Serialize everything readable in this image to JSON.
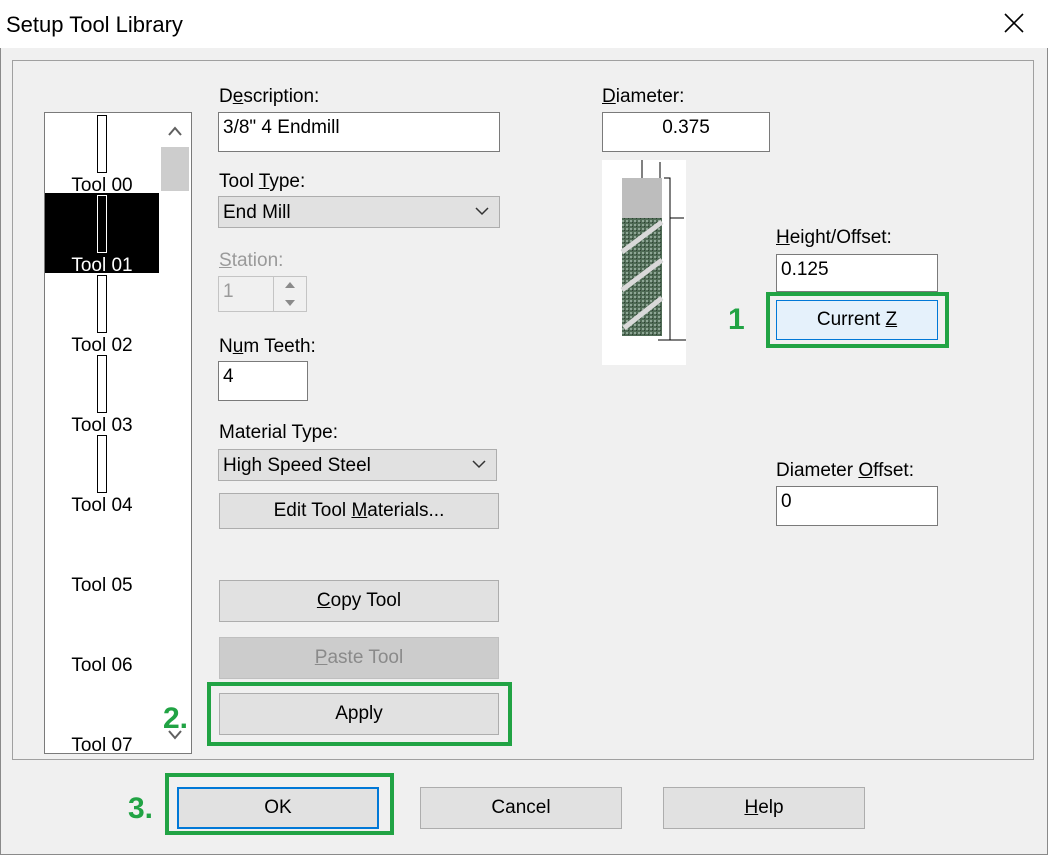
{
  "window": {
    "title": "Setup Tool Library"
  },
  "tool_list": {
    "items": [
      "Tool 00",
      "Tool 01",
      "Tool 02",
      "Tool 03",
      "Tool 04",
      "Tool 05",
      "Tool 06",
      "Tool 07"
    ],
    "selected": "Tool 01"
  },
  "description": {
    "label_pre": "D",
    "label_u": "e",
    "label_post": "scription:",
    "value": "3/8\" 4 Endmill"
  },
  "tool_type": {
    "label_pre": "Tool ",
    "label_u": "T",
    "label_post": "ype:",
    "value": "End Mill"
  },
  "station": {
    "label_pre": "",
    "label_u": "S",
    "label_post": "tation:",
    "value": "1"
  },
  "num_teeth": {
    "label_pre": "N",
    "label_u": "u",
    "label_post": "m Teeth:",
    "value": "4"
  },
  "material_type": {
    "label": "Material Type:",
    "value": "High Speed Steel"
  },
  "buttons": {
    "edit_materials": {
      "pre": "Edit Tool ",
      "u": "M",
      "post": "aterials..."
    },
    "copy_tool": {
      "pre": "",
      "u": "C",
      "post": "opy Tool"
    },
    "paste_tool": {
      "pre": "",
      "u": "P",
      "post": "aste Tool"
    },
    "apply": "Apply",
    "current_z": {
      "pre": "Current ",
      "u": "Z",
      "post": ""
    },
    "ok": "OK",
    "cancel": "Cancel",
    "help": {
      "pre": "",
      "u": "H",
      "post": "elp"
    }
  },
  "diameter": {
    "label_pre": "",
    "label_u": "D",
    "label_post": "iameter:",
    "value": "0.375"
  },
  "height_offset": {
    "label_pre": "",
    "label_u": "H",
    "label_post": "eight/Offset:",
    "value": "0.125"
  },
  "diameter_offset": {
    "label_pre": "Diameter ",
    "label_u": "O",
    "label_post": "ffset:",
    "value": "0"
  },
  "annotations": {
    "step1": "1",
    "step2": "2.",
    "step3": "3."
  },
  "colors": {
    "highlight": "#21a344",
    "focus_border": "#0078d7"
  }
}
